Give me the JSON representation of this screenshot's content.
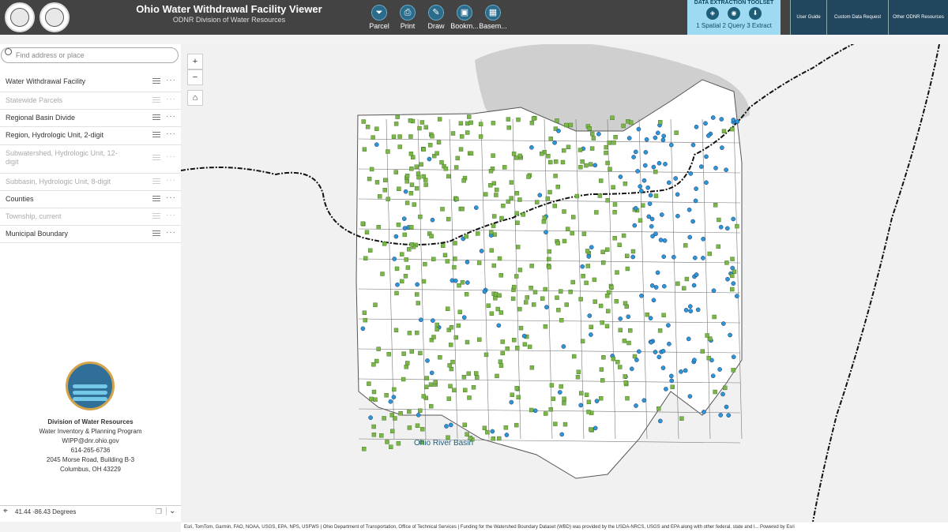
{
  "header": {
    "title": "Ohio Water Withdrawal Facility Viewer",
    "subtitle": "ODNR Division of Water Resources",
    "tools": [
      {
        "label": "Parcel",
        "icon": "filter-icon"
      },
      {
        "label": "Print",
        "icon": "print-icon"
      },
      {
        "label": "Draw",
        "icon": "draw-icon"
      },
      {
        "label": "Bookm...",
        "icon": "bookmark-icon"
      },
      {
        "label": "Basem...",
        "icon": "basemap-icon"
      }
    ],
    "extraction": {
      "title": "DATA EXTRACTION TOOLSET",
      "steps": "1 Spatial 2 Query 3 Extract"
    },
    "links": [
      "User Guide",
      "Custom Data Request",
      "Other ODNR Resources"
    ]
  },
  "search": {
    "placeholder": "Find address or place"
  },
  "layers": [
    {
      "name": "Water Withdrawal Facility",
      "active": true
    },
    {
      "name": "Statewide Parcels",
      "active": false
    },
    {
      "name": "Regional Basin Divide",
      "active": true
    },
    {
      "name": "Region, Hydrologic Unit, 2-digit",
      "active": true
    },
    {
      "name": "Subwatershed, Hydrologic Unit, 12-digit",
      "active": false
    },
    {
      "name": "Subbasin, Hydrologic Unit, 8-digit",
      "active": false
    },
    {
      "name": "Counties",
      "active": true
    },
    {
      "name": "Township, current",
      "active": false
    },
    {
      "name": "Municipal Boundary",
      "active": true
    }
  ],
  "contact": {
    "org": "Division of Water Resources",
    "program": "Water Inventory & Planning Program",
    "email": "WIPP@dnr.ohio.gov",
    "phone": "614-265-6736",
    "address1": "2045 Morse Road, Building B-3",
    "address2": "Columbus, OH 43229"
  },
  "coordinates": "41.44 -86.43 Degrees",
  "map": {
    "basin_label": "Ohio River Basin",
    "colors": {
      "green": "#7ab648",
      "blue": "#2b97d4",
      "lake": "#cfcfcf"
    }
  },
  "attribution": "Esri, TomTom, Garmin, FAO, NOAA, USGS, EPA, NPS, USFWS | Ohio Department of Transportation, Office of Technical Services | Funding for the Watershed Boundary Dataset (WBD) was provided by the USDA-NRCS, USGS and EPA along with other federal, state and l...   Powered by Esri"
}
